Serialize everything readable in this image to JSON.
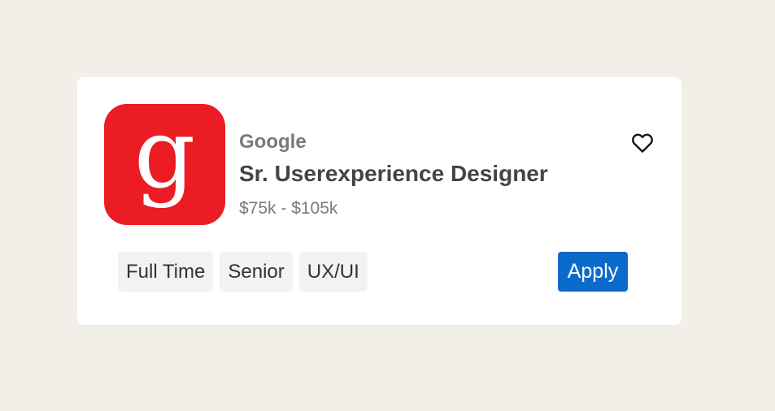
{
  "job": {
    "logo_letter": "g",
    "logo_color": "#ec1c24",
    "company": "Google",
    "title": "Sr. Userexperience Designer",
    "salary": "$75k - $105k",
    "favorite_icon": "heart-outline-icon",
    "tags": [
      "Full Time",
      "Senior",
      "UX/UI"
    ],
    "apply_label": "Apply",
    "apply_color": "#0a6bcb"
  }
}
